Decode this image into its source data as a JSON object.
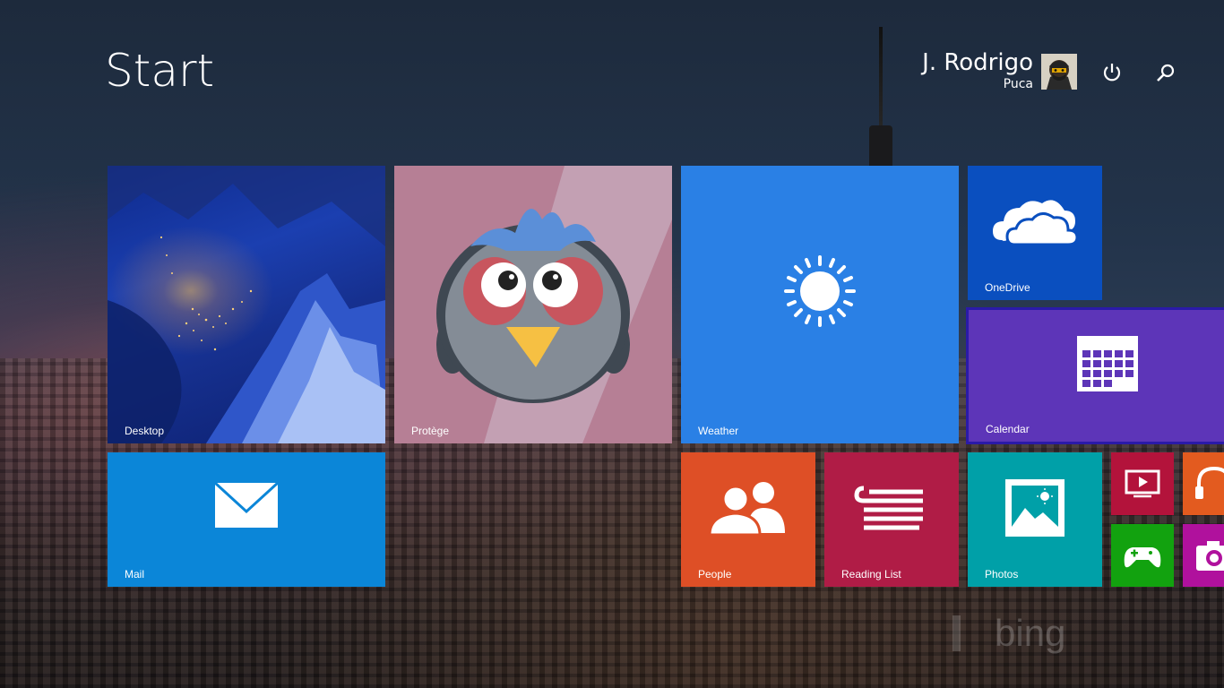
{
  "screen": {
    "title": "Start"
  },
  "user": {
    "name": "J. Rodrigo",
    "subtitle": "Puca"
  },
  "header": {
    "power_icon": "power-icon",
    "search_icon": "search-icon"
  },
  "tiles": {
    "desktop": {
      "label": "Desktop"
    },
    "protege": {
      "label": "Protège"
    },
    "weather": {
      "label": "Weather"
    },
    "onedrive": {
      "label": "OneDrive"
    },
    "calendar": {
      "label": "Calendar"
    },
    "mail": {
      "label": "Mail"
    },
    "people": {
      "label": "People"
    },
    "reading_list": {
      "label": "Reading List"
    },
    "photos": {
      "label": "Photos"
    },
    "video": {
      "icon": "video-icon"
    },
    "music": {
      "icon": "headphones-icon"
    },
    "games": {
      "icon": "gamepad-icon"
    },
    "camera": {
      "icon": "camera-icon"
    }
  },
  "watermark": {
    "text": "bing"
  },
  "colors": {
    "weather": "#2a80e5",
    "onedrive": "#0a4fbf",
    "calendar": "#5d35b8",
    "mail": "#0b86d8",
    "people": "#de4f26",
    "reading_list": "#b01c46",
    "photos": "#00a0a8",
    "protege": "#b67f95"
  }
}
